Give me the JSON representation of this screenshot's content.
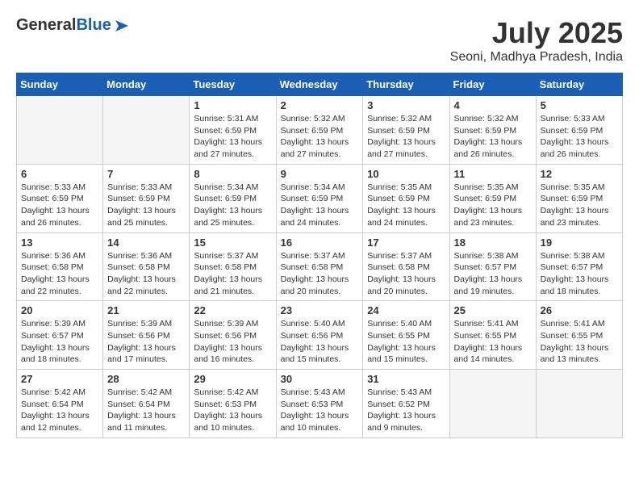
{
  "header": {
    "logo_general": "General",
    "logo_blue": "Blue",
    "month_year": "July 2025",
    "location": "Seoni, Madhya Pradesh, India"
  },
  "calendar": {
    "days_of_week": [
      "Sunday",
      "Monday",
      "Tuesday",
      "Wednesday",
      "Thursday",
      "Friday",
      "Saturday"
    ],
    "weeks": [
      [
        {
          "day": "",
          "info": ""
        },
        {
          "day": "",
          "info": ""
        },
        {
          "day": "1",
          "info": "Sunrise: 5:31 AM\nSunset: 6:59 PM\nDaylight: 13 hours\nand 27 minutes."
        },
        {
          "day": "2",
          "info": "Sunrise: 5:32 AM\nSunset: 6:59 PM\nDaylight: 13 hours\nand 27 minutes."
        },
        {
          "day": "3",
          "info": "Sunrise: 5:32 AM\nSunset: 6:59 PM\nDaylight: 13 hours\nand 27 minutes."
        },
        {
          "day": "4",
          "info": "Sunrise: 5:32 AM\nSunset: 6:59 PM\nDaylight: 13 hours\nand 26 minutes."
        },
        {
          "day": "5",
          "info": "Sunrise: 5:33 AM\nSunset: 6:59 PM\nDaylight: 13 hours\nand 26 minutes."
        }
      ],
      [
        {
          "day": "6",
          "info": "Sunrise: 5:33 AM\nSunset: 6:59 PM\nDaylight: 13 hours\nand 26 minutes."
        },
        {
          "day": "7",
          "info": "Sunrise: 5:33 AM\nSunset: 6:59 PM\nDaylight: 13 hours\nand 25 minutes."
        },
        {
          "day": "8",
          "info": "Sunrise: 5:34 AM\nSunset: 6:59 PM\nDaylight: 13 hours\nand 25 minutes."
        },
        {
          "day": "9",
          "info": "Sunrise: 5:34 AM\nSunset: 6:59 PM\nDaylight: 13 hours\nand 24 minutes."
        },
        {
          "day": "10",
          "info": "Sunrise: 5:35 AM\nSunset: 6:59 PM\nDaylight: 13 hours\nand 24 minutes."
        },
        {
          "day": "11",
          "info": "Sunrise: 5:35 AM\nSunset: 6:59 PM\nDaylight: 13 hours\nand 23 minutes."
        },
        {
          "day": "12",
          "info": "Sunrise: 5:35 AM\nSunset: 6:59 PM\nDaylight: 13 hours\nand 23 minutes."
        }
      ],
      [
        {
          "day": "13",
          "info": "Sunrise: 5:36 AM\nSunset: 6:58 PM\nDaylight: 13 hours\nand 22 minutes."
        },
        {
          "day": "14",
          "info": "Sunrise: 5:36 AM\nSunset: 6:58 PM\nDaylight: 13 hours\nand 22 minutes."
        },
        {
          "day": "15",
          "info": "Sunrise: 5:37 AM\nSunset: 6:58 PM\nDaylight: 13 hours\nand 21 minutes."
        },
        {
          "day": "16",
          "info": "Sunrise: 5:37 AM\nSunset: 6:58 PM\nDaylight: 13 hours\nand 20 minutes."
        },
        {
          "day": "17",
          "info": "Sunrise: 5:37 AM\nSunset: 6:58 PM\nDaylight: 13 hours\nand 20 minutes."
        },
        {
          "day": "18",
          "info": "Sunrise: 5:38 AM\nSunset: 6:57 PM\nDaylight: 13 hours\nand 19 minutes."
        },
        {
          "day": "19",
          "info": "Sunrise: 5:38 AM\nSunset: 6:57 PM\nDaylight: 13 hours\nand 18 minutes."
        }
      ],
      [
        {
          "day": "20",
          "info": "Sunrise: 5:39 AM\nSunset: 6:57 PM\nDaylight: 13 hours\nand 18 minutes."
        },
        {
          "day": "21",
          "info": "Sunrise: 5:39 AM\nSunset: 6:56 PM\nDaylight: 13 hours\nand 17 minutes."
        },
        {
          "day": "22",
          "info": "Sunrise: 5:39 AM\nSunset: 6:56 PM\nDaylight: 13 hours\nand 16 minutes."
        },
        {
          "day": "23",
          "info": "Sunrise: 5:40 AM\nSunset: 6:56 PM\nDaylight: 13 hours\nand 15 minutes."
        },
        {
          "day": "24",
          "info": "Sunrise: 5:40 AM\nSunset: 6:55 PM\nDaylight: 13 hours\nand 15 minutes."
        },
        {
          "day": "25",
          "info": "Sunrise: 5:41 AM\nSunset: 6:55 PM\nDaylight: 13 hours\nand 14 minutes."
        },
        {
          "day": "26",
          "info": "Sunrise: 5:41 AM\nSunset: 6:55 PM\nDaylight: 13 hours\nand 13 minutes."
        }
      ],
      [
        {
          "day": "27",
          "info": "Sunrise: 5:42 AM\nSunset: 6:54 PM\nDaylight: 13 hours\nand 12 minutes."
        },
        {
          "day": "28",
          "info": "Sunrise: 5:42 AM\nSunset: 6:54 PM\nDaylight: 13 hours\nand 11 minutes."
        },
        {
          "day": "29",
          "info": "Sunrise: 5:42 AM\nSunset: 6:53 PM\nDaylight: 13 hours\nand 10 minutes."
        },
        {
          "day": "30",
          "info": "Sunrise: 5:43 AM\nSunset: 6:53 PM\nDaylight: 13 hours\nand 10 minutes."
        },
        {
          "day": "31",
          "info": "Sunrise: 5:43 AM\nSunset: 6:52 PM\nDaylight: 13 hours\nand 9 minutes."
        },
        {
          "day": "",
          "info": ""
        },
        {
          "day": "",
          "info": ""
        }
      ]
    ]
  }
}
